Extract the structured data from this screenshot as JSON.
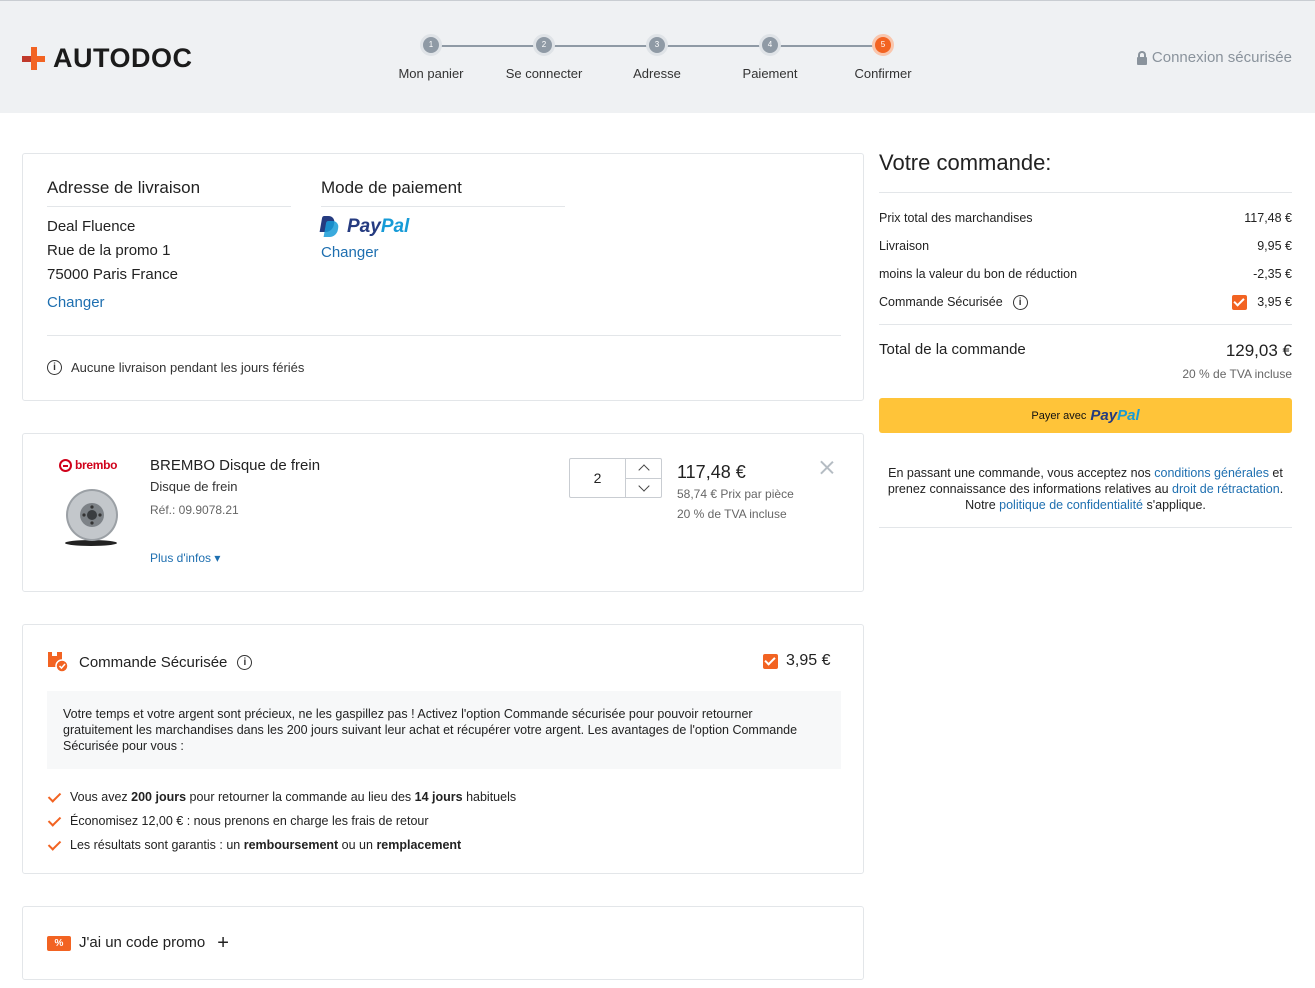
{
  "header": {
    "logo": "AUTODOC",
    "secure_label": "Connexion sécurisée",
    "steps": [
      {
        "num": "1",
        "label": "Mon panier"
      },
      {
        "num": "2",
        "label": "Se connecter"
      },
      {
        "num": "3",
        "label": "Adresse"
      },
      {
        "num": "4",
        "label": "Paiement"
      },
      {
        "num": "5",
        "label": "Confirmer"
      }
    ],
    "active_step": 5
  },
  "delivery": {
    "title": "Adresse de livraison",
    "name": "Deal Fluence",
    "street": "Rue de la promo 1",
    "city": "75000 Paris France",
    "change": "Changer"
  },
  "payment": {
    "title": "Mode de paiement",
    "method_pay": "Pay",
    "method_pal": "Pal",
    "change": "Changer"
  },
  "holiday_note": "Aucune livraison pendant les jours fériés",
  "product": {
    "brand": "brembo",
    "title": "BREMBO Disque de frein",
    "subtitle": "Disque de frein",
    "ref": "Réf.: 09.9078.21",
    "more": "Plus d'infos ▾",
    "qty": "2",
    "price": "117,48 €",
    "unit_price": "58,74 € Prix par pièce",
    "tva": "20 % de TVA incluse"
  },
  "secure_order": {
    "title": "Commande Sécurisée",
    "price": "3,95 €",
    "description": "Votre temps et votre argent sont précieux, ne les gaspillez pas ! Activez l'option Commande sécurisée pour pouvoir retourner gratuitement les marchandises dans les 200 jours suivant leur achat et récupérer votre argent. Les avantages de l'option Commande Sécurisée pour vous :",
    "benefits": [
      {
        "a": "Vous avez ",
        "b": "200 jours",
        "c": " pour retourner la commande au lieu des ",
        "d": "14 jours",
        "e": " habituels"
      },
      {
        "a": "Économisez 12,00 € : nous prenons en charge les frais de retour"
      },
      {
        "a": "Les résultats sont garantis : un ",
        "b": "remboursement",
        "c": " ou un ",
        "d": "remplacement"
      }
    ]
  },
  "promo": {
    "icon": "%",
    "label": "J'ai un code promo",
    "plus": "+"
  },
  "summary": {
    "title": "Votre commande:",
    "rows": [
      {
        "label": "Prix total des marchandises",
        "value": "117,48 €"
      },
      {
        "label": "Livraison",
        "value": "9,95 €"
      },
      {
        "label": "moins la valeur du bon de réduction",
        "value": "-2,35 €"
      },
      {
        "label": "Commande Sécurisée",
        "value": "3,95 €"
      }
    ],
    "total_label": "Total de la commande",
    "total_value": "129,03 €",
    "total_tva": "20 % de TVA incluse",
    "pay_prefix": "Payer avec",
    "pay_brand_1": "Pay",
    "pay_brand_2": "Pal",
    "terms": {
      "t1": "En passant une commande, vous acceptez nos ",
      "l1": "conditions générales",
      "t2": " et prenez connaissance des informations relatives au ",
      "l2": "droit de rétractation",
      "t3": ". Notre ",
      "l3": "politique de confidentialité",
      "t4": " s'applique."
    }
  },
  "colors": {
    "accent": "#f26322",
    "link": "#1e6fb0",
    "paypal_button": "#ffc439",
    "paypal_dark": "#253b80",
    "paypal_light": "#179bd7"
  }
}
